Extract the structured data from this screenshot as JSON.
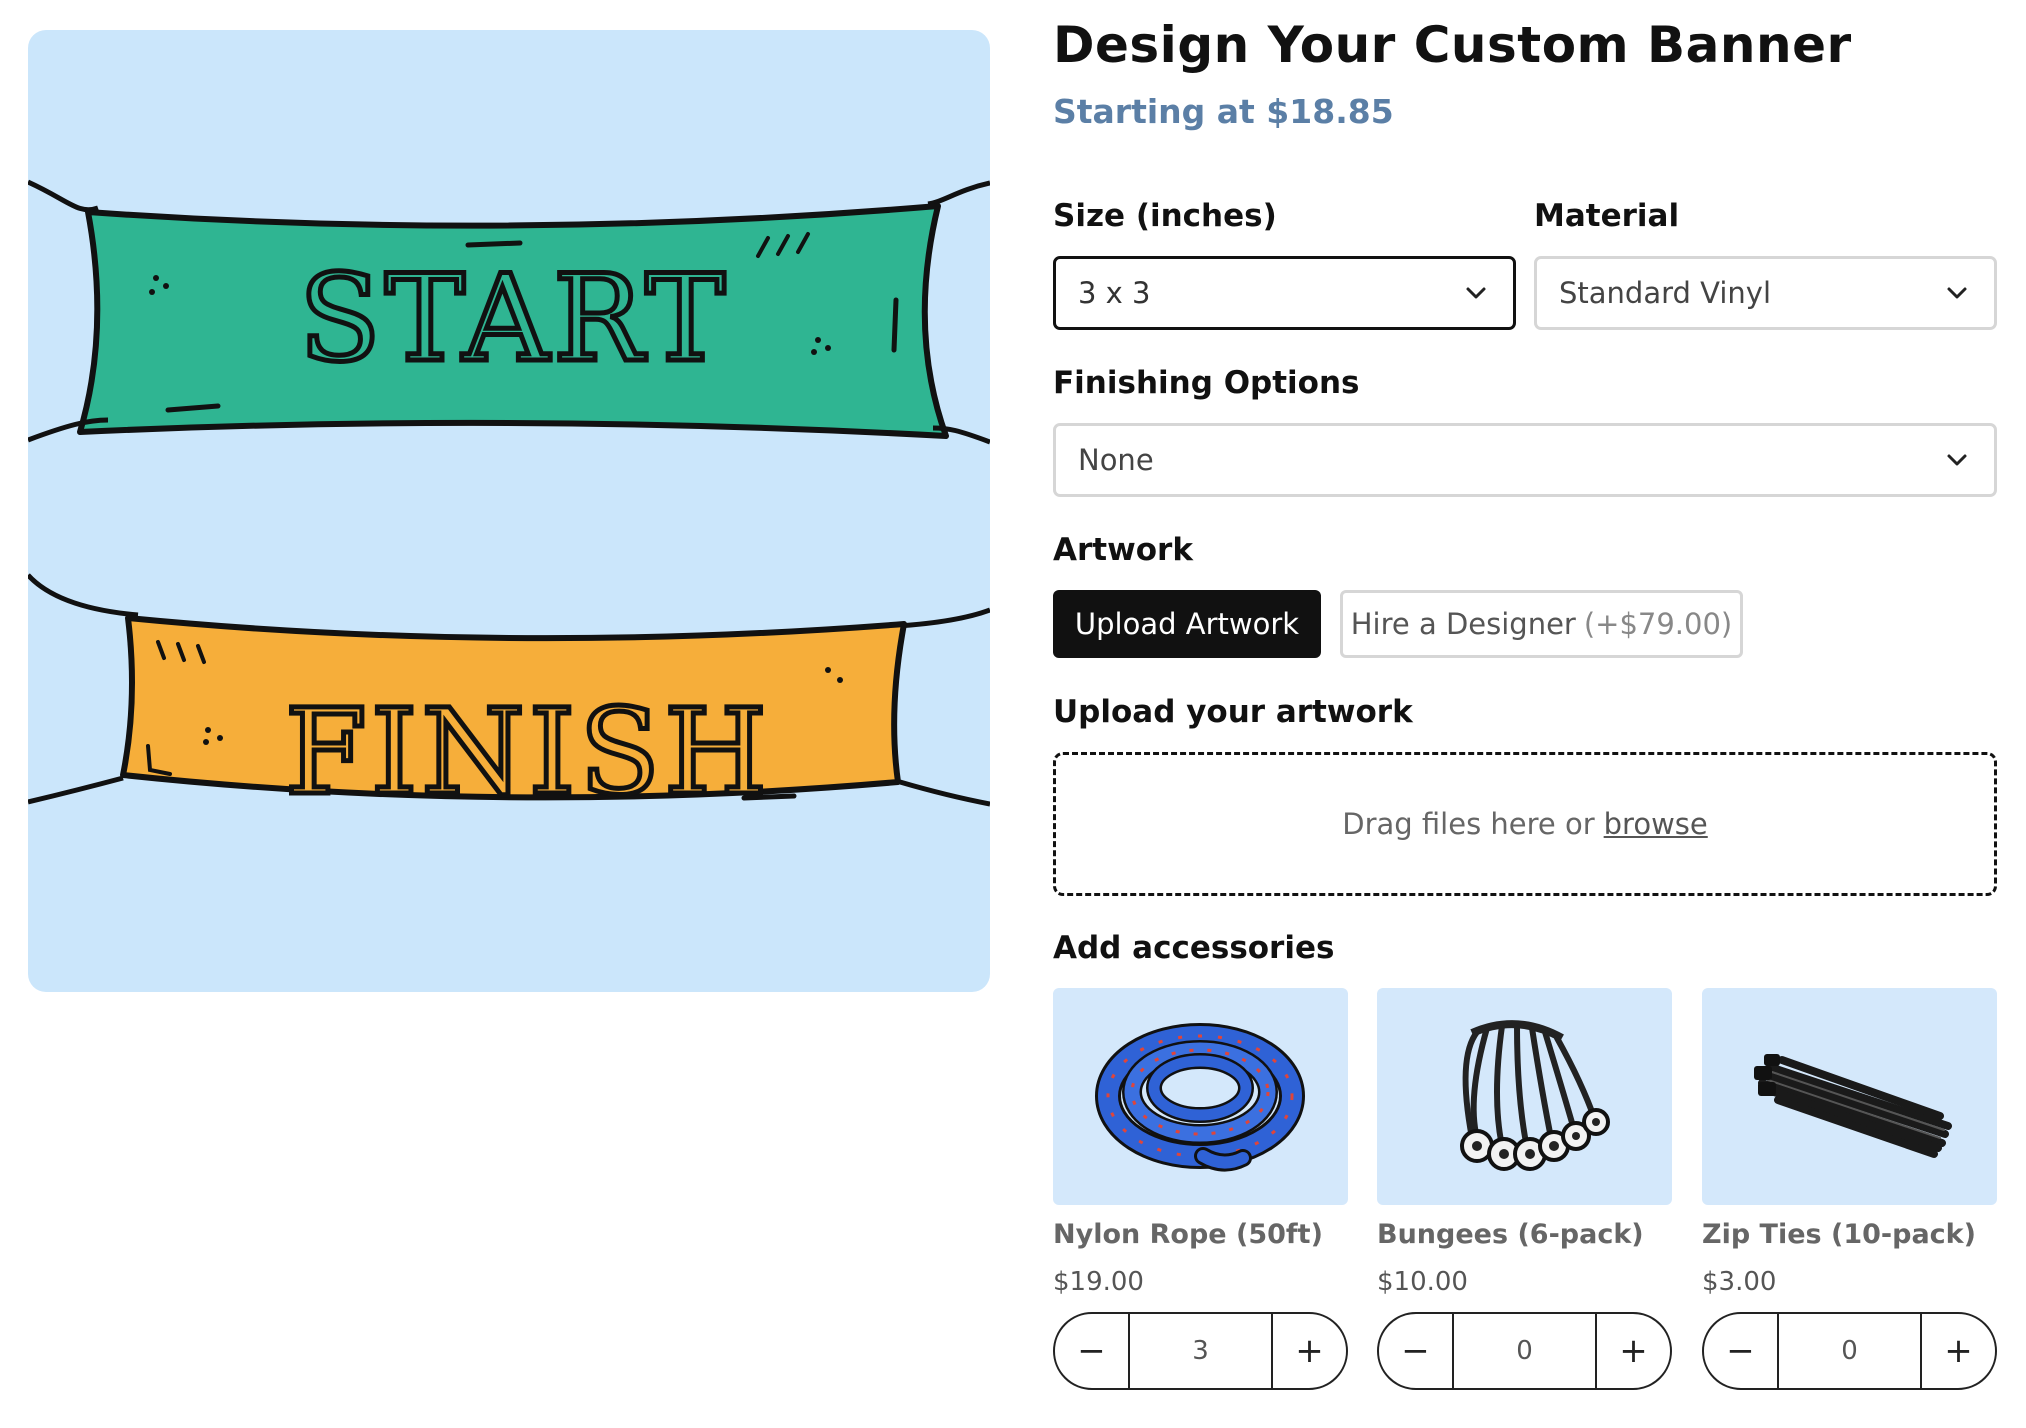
{
  "hero": {
    "banner_top_text": "START",
    "banner_bottom_text": "FINISH",
    "colors": {
      "background": "#cbe6fb",
      "banner_top": "#2fb592",
      "banner_bottom": "#f6ae3a"
    }
  },
  "product": {
    "title": "Design Your Custom Banner",
    "starting_price": "Starting at $18.85"
  },
  "options": {
    "size_label": "Size (inches)",
    "size_value": "3 x 3",
    "material_label": "Material",
    "material_value": "Standard Vinyl",
    "finishing_label": "Finishing Options",
    "finishing_value": "None"
  },
  "artwork": {
    "label": "Artwork",
    "upload_button": "Upload Artwork",
    "designer_button": "Hire a Designer",
    "designer_price": "(+$79.00)"
  },
  "upload": {
    "label": "Upload your artwork",
    "drop_text": "Drag files here or",
    "browse_link": "browse"
  },
  "accessories": {
    "label": "Add accessories",
    "items": [
      {
        "name": "Nylon Rope (50ft)",
        "price": "$19.00",
        "quantity": "3",
        "icon": "rope-icon"
      },
      {
        "name": "Bungees (6-pack)",
        "price": "$10.00",
        "quantity": "0",
        "icon": "bungee-icon"
      },
      {
        "name": "Zip Ties (10-pack)",
        "price": "$3.00",
        "quantity": "0",
        "icon": "zip-ties-icon"
      }
    ],
    "minus_symbol": "−",
    "plus_symbol": "+"
  }
}
